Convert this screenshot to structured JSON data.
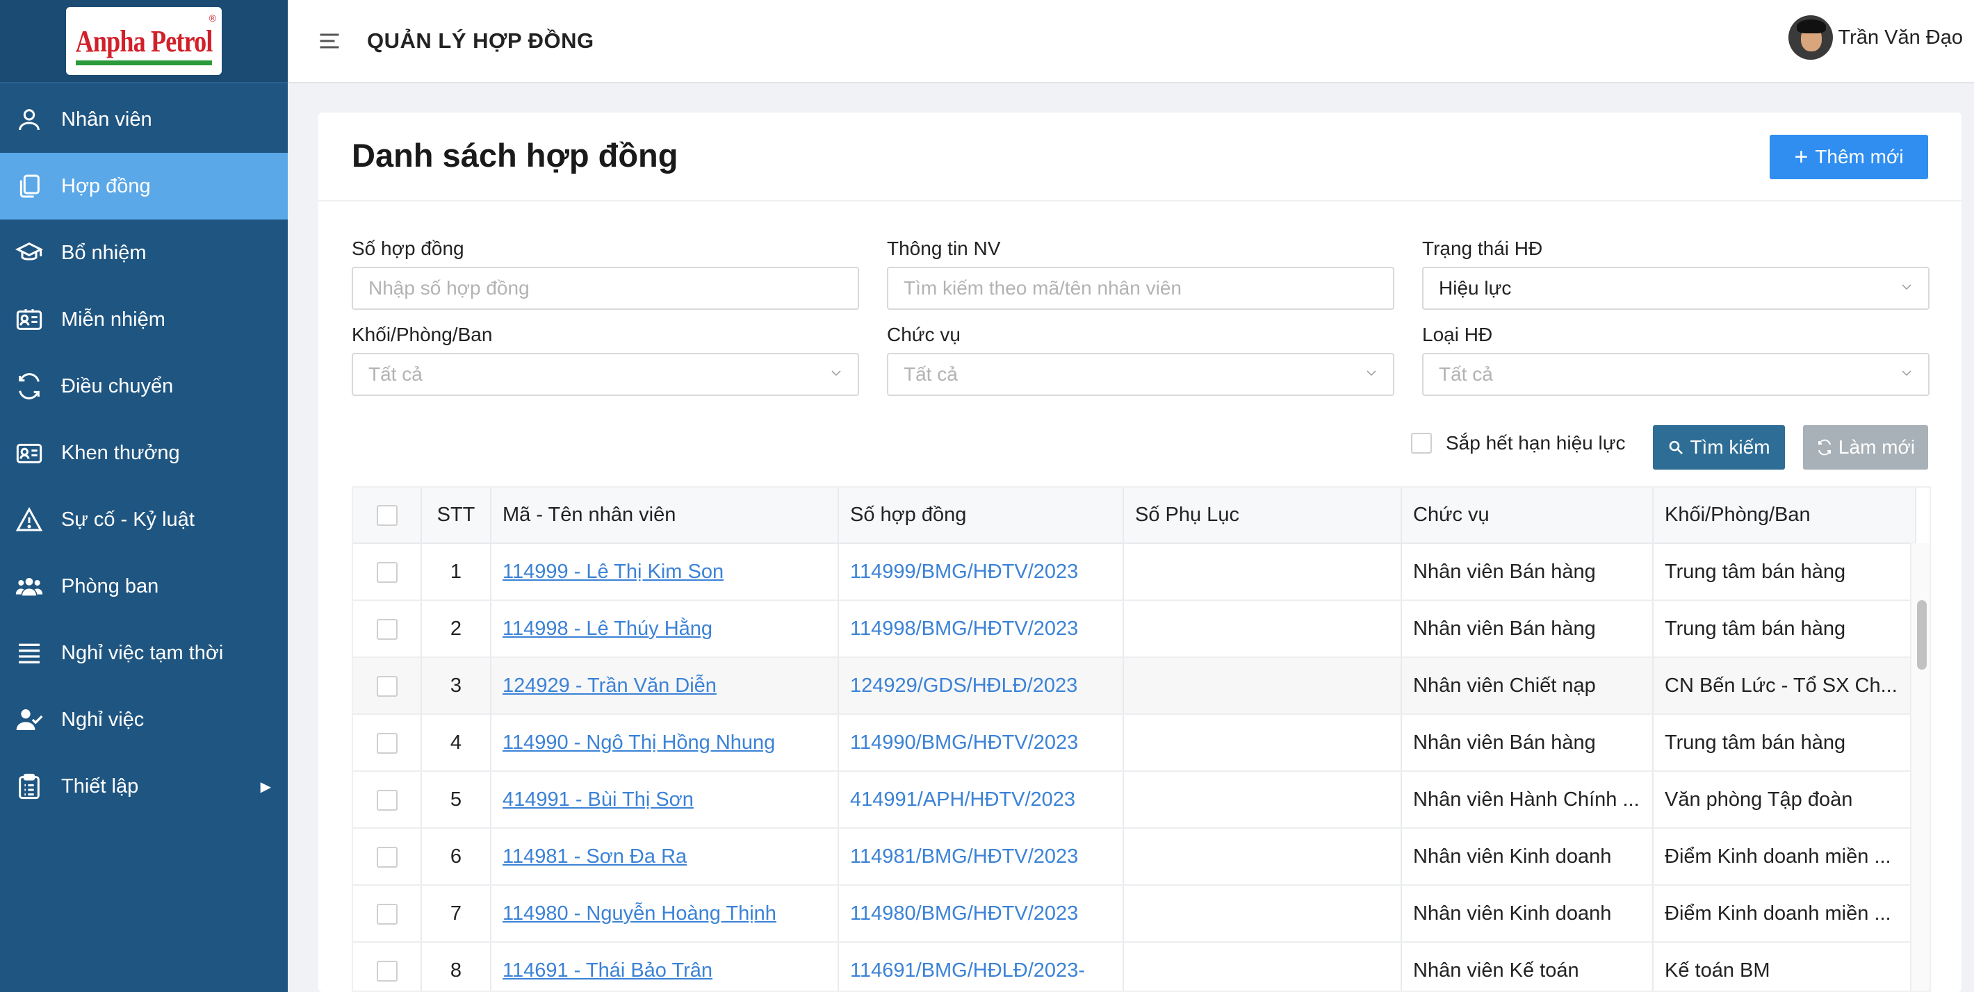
{
  "brand": {
    "logo_text": "Anpha Petrol",
    "logo_mark": "®"
  },
  "header": {
    "title": "QUẢN LÝ HỢP ĐỒNG",
    "user_name": "Trần Văn Đạo"
  },
  "sidebar": {
    "items": [
      {
        "label": "Nhân viên",
        "icon": "user-icon",
        "active": false
      },
      {
        "label": "Hợp đồng",
        "icon": "document-copy-icon",
        "active": true
      },
      {
        "label": "Bổ nhiệm",
        "icon": "graduation-cap-icon",
        "active": false
      },
      {
        "label": "Miễn nhiệm",
        "icon": "id-card-icon",
        "active": false
      },
      {
        "label": "Điều chuyển",
        "icon": "transfer-icon",
        "active": false
      },
      {
        "label": "Khen thưởng",
        "icon": "award-card-icon",
        "active": false
      },
      {
        "label": "Sự cố - Kỷ luật",
        "icon": "warning-icon",
        "active": false
      },
      {
        "label": "Phòng ban",
        "icon": "group-icon",
        "active": false
      },
      {
        "label": "Nghỉ việc tạm thời",
        "icon": "list-icon",
        "active": false
      },
      {
        "label": "Nghỉ việc",
        "icon": "user-check-icon",
        "active": false
      },
      {
        "label": "Thiết lập",
        "icon": "clipboard-icon",
        "active": false,
        "has_submenu": true
      }
    ]
  },
  "main": {
    "title": "Danh sách hợp đồng",
    "add_button": "Thêm mới",
    "filters": {
      "contract_no": {
        "label": "Số hợp đồng",
        "placeholder": "Nhập số hợp đồng"
      },
      "employee": {
        "label": "Thông tin NV",
        "placeholder": "Tìm kiếm theo mã/tên nhân viên"
      },
      "status": {
        "label": "Trạng thái HĐ",
        "value": "Hiệu lực"
      },
      "department": {
        "label": "Khối/Phòng/Ban",
        "value": "Tất cả"
      },
      "position": {
        "label": "Chức vụ",
        "value": "Tất cả"
      },
      "type": {
        "label": "Loại HĐ",
        "value": "Tất cả"
      }
    },
    "expiring_label": "Sắp hết hạn hiệu lực",
    "search_button": "Tìm kiếm",
    "reset_button": "Làm mới"
  },
  "table": {
    "columns": [
      "STT",
      "Mã - Tên nhân viên",
      "Số hợp đồng",
      "Số Phụ Lục",
      "Chức vụ",
      "Khối/Phòng/Ban"
    ],
    "rows": [
      {
        "stt": "1",
        "employee": "114999 - Lê Thị Kim Son",
        "contract": "114999/BMG/HĐTV/2023",
        "appendix": "",
        "position": "Nhân viên Bán hàng",
        "department": "Trung tâm bán hàng"
      },
      {
        "stt": "2",
        "employee": "114998 - Lê Thúy Hằng",
        "contract": "114998/BMG/HĐTV/2023",
        "appendix": "",
        "position": "Nhân viên Bán hàng",
        "department": "Trung tâm bán hàng"
      },
      {
        "stt": "3",
        "employee": "124929 - Trần Văn Diễn",
        "contract": "124929/GDS/HĐLĐ/2023",
        "appendix": "",
        "position": "Nhân viên Chiết nạp",
        "department": "CN Bến Lức - Tổ SX Ch..."
      },
      {
        "stt": "4",
        "employee": "114990 - Ngô Thị Hồng Nhung",
        "contract": "114990/BMG/HĐTV/2023",
        "appendix": "",
        "position": "Nhân viên Bán hàng",
        "department": "Trung tâm bán hàng"
      },
      {
        "stt": "5",
        "employee": "414991 - Bùi Thị Sơn",
        "contract": "414991/APH/HĐTV/2023",
        "appendix": "",
        "position": "Nhân viên Hành Chính ...",
        "department": "Văn phòng Tập đoàn"
      },
      {
        "stt": "6",
        "employee": "114981 - Sơn Đa Ra",
        "contract": "114981/BMG/HĐTV/2023",
        "appendix": "",
        "position": "Nhân viên Kinh doanh",
        "department": "Điểm Kinh doanh miền ..."
      },
      {
        "stt": "7",
        "employee": "114980 - Nguyễn Hoàng Thịnh",
        "contract": "114980/BMG/HĐTV/2023",
        "appendix": "",
        "position": "Nhân viên Kinh doanh",
        "department": "Điểm Kinh doanh miền ..."
      },
      {
        "stt": "8",
        "employee": "114691 - Thái Bảo Trân",
        "contract": "114691/BMG/HĐLĐ/2023-",
        "appendix": "",
        "position": "Nhân viên Kế toán",
        "department": "Kế toán BM"
      }
    ]
  },
  "colors": {
    "sidebar_bg": "#1f5581",
    "sidebar_active": "#5aa8e8",
    "primary": "#2f8ef0",
    "search_btn": "#2e6e96",
    "reset_btn": "#a9b1b8",
    "link": "#3b82d6",
    "logo_red": "#d2202a"
  }
}
